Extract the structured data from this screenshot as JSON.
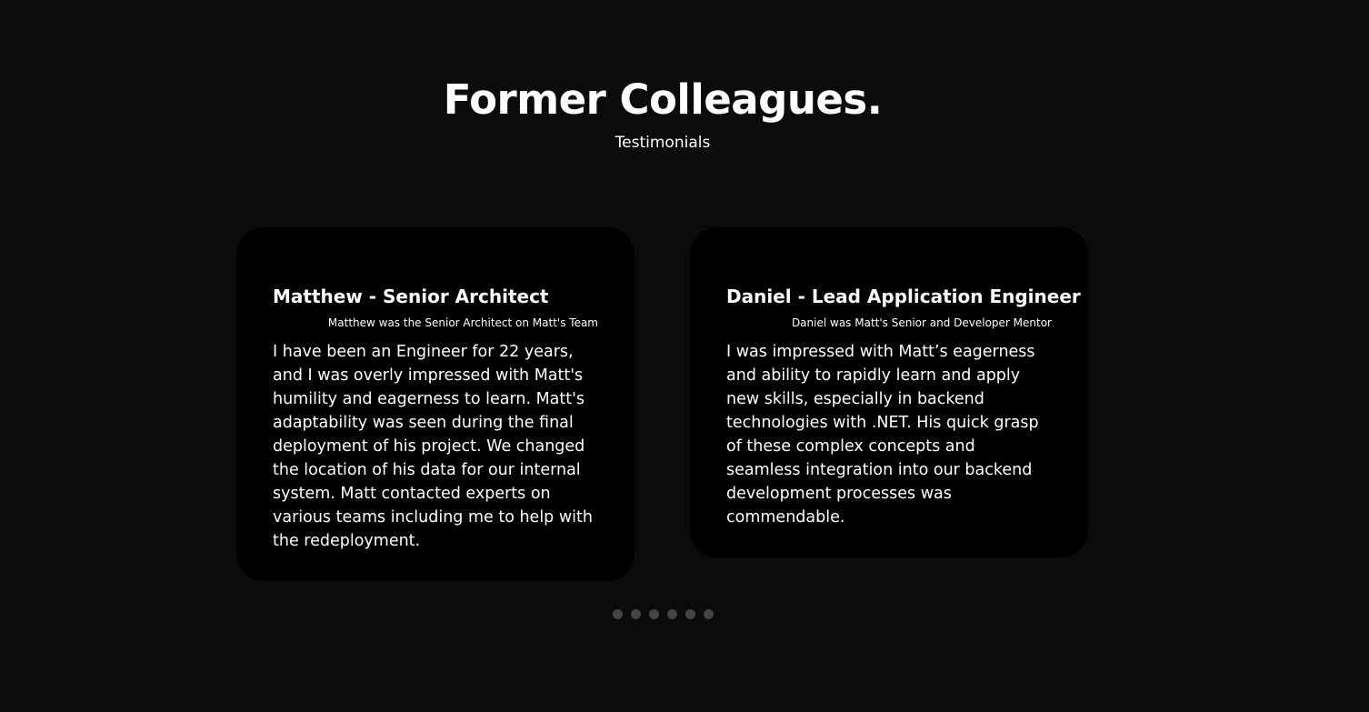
{
  "header": {
    "title": "Former Colleagues.",
    "subtitle": "Testimonials"
  },
  "testimonials": [
    {
      "name": "Matthew - Senior Architect",
      "role": "Matthew was the Senior Architect on Matt's Team",
      "quote": "I have been an Engineer for 22 years, and I was overly impressed with Matt's humility and eagerness to learn. Matt's adaptability was seen during the final deployment of his project. We changed the location of his data for our internal system. Matt contacted experts on various teams including me to help with the redeployment."
    },
    {
      "name": "Daniel - Lead Application Engineer",
      "role": "Daniel was Matt's Senior and Developer Mentor",
      "quote": "I was impressed with Matt’s eagerness and ability to rapidly learn and apply new skills, especially in backend technologies with .NET. His quick grasp of these complex concepts and seamless integration into our backend development processes was commendable."
    }
  ],
  "pagination": {
    "dot_count": 6,
    "dot_color": "#444444"
  },
  "colors": {
    "background": "#0b0b0b",
    "card": "#000000",
    "text": "#ffffff"
  }
}
